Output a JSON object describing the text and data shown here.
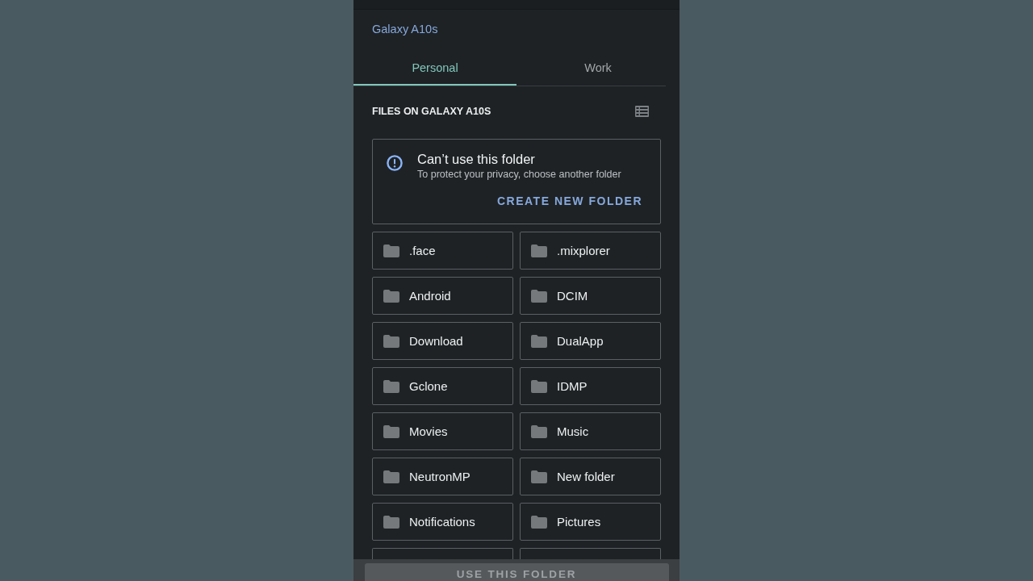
{
  "device": {
    "title": "Galaxy A10s"
  },
  "tabs": [
    {
      "label": "Personal",
      "selected": true
    },
    {
      "label": "Work",
      "selected": false
    }
  ],
  "section": {
    "heading": "FILES ON GALAXY A10S"
  },
  "notice": {
    "title": "Can’t use this folder",
    "message": "To protect your privacy, choose another folder",
    "action": "CREATE NEW FOLDER"
  },
  "folders": [
    {
      "kind": "folder",
      "label": ".face"
    },
    {
      "kind": "folder",
      "label": ".mixplorer"
    },
    {
      "kind": "folder",
      "label": "Android"
    },
    {
      "kind": "folder",
      "label": "DCIM"
    },
    {
      "kind": "folder",
      "label": "Download"
    },
    {
      "kind": "folder",
      "label": "DualApp"
    },
    {
      "kind": "folder",
      "label": "Gclone"
    },
    {
      "kind": "folder",
      "label": "IDMP"
    },
    {
      "kind": "folder",
      "label": "Movies"
    },
    {
      "kind": "folder",
      "label": "Music"
    },
    {
      "kind": "folder",
      "label": "NeutronMP"
    },
    {
      "kind": "folder",
      "label": "New folder"
    },
    {
      "kind": "folder",
      "label": "Notifications"
    },
    {
      "kind": "folder",
      "label": "Pictures"
    },
    {
      "kind": "cut"
    },
    {
      "kind": "cut"
    }
  ],
  "bottom_button": {
    "label": "USE THIS FOLDER",
    "disabled": true
  }
}
